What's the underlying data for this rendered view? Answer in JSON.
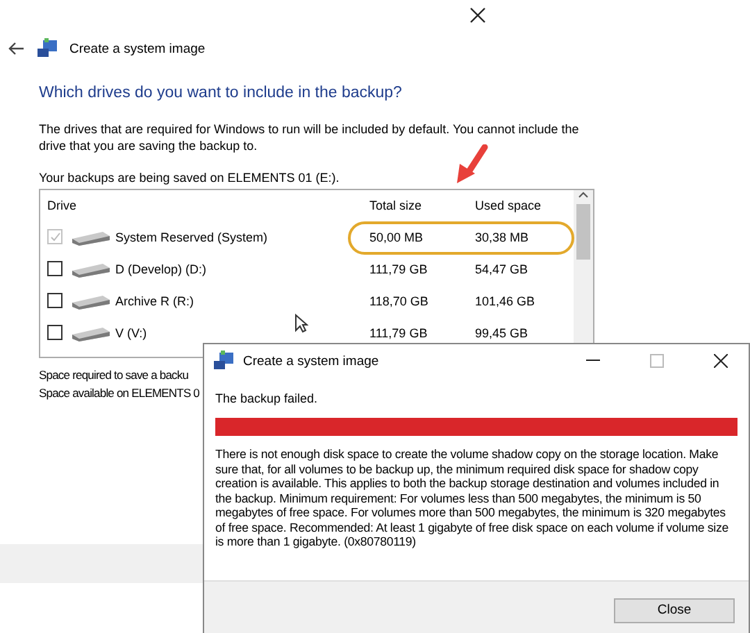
{
  "window": {
    "title": "Create a system image",
    "heading": "Which drives do you want to include in the backup?",
    "description": "The drives that are required for Windows to run will be included by default. You cannot include the drive that you are saving the backup to.",
    "save_location": "Your backups are being saved on ELEMENTS 01 (E:).",
    "table": {
      "columns": [
        "Drive",
        "Total size",
        "Used space"
      ],
      "rows": [
        {
          "name": "System Reserved (System)",
          "total": "50,00 MB",
          "used": "30,38 MB",
          "checked": true,
          "disabled": true,
          "highlighted": true
        },
        {
          "name": "D (Develop) (D:)",
          "total": "111,79 GB",
          "used": "54,47 GB",
          "checked": false,
          "disabled": false,
          "highlighted": false
        },
        {
          "name": "Archive R (R:)",
          "total": "118,70 GB",
          "used": "101,46 GB",
          "checked": false,
          "disabled": false,
          "highlighted": false
        },
        {
          "name": "V (V:)",
          "total": "111,79 GB",
          "used": "99,45 GB",
          "checked": false,
          "disabled": false,
          "highlighted": false
        }
      ]
    },
    "space_required": "Space required to save a backu",
    "space_available": "Space available on ELEMENTS 0"
  },
  "dialog": {
    "title": "Create a system image",
    "status": "The backup failed.",
    "level": 1,
    "message": "There is not enough disk space to create the volume shadow copy on the storage location. Make sure that, for all volumes to be backup up, the minimum required disk space for shadow copy creation is available. This applies to both the backup storage destination and volumes included in the backup. Minimum requirement: For volumes less than 500 megabytes, the minimum is 50 megabytes of free space. For volumes more than 500 megabytes, the minimum is 320 megabytes of free space.  Recommended: At least 1 gigabyte of free disk space on each volume if volume size is more than 1 gigabyte. (0x80780119)",
    "buttons": [
      "Close"
    ]
  }
}
